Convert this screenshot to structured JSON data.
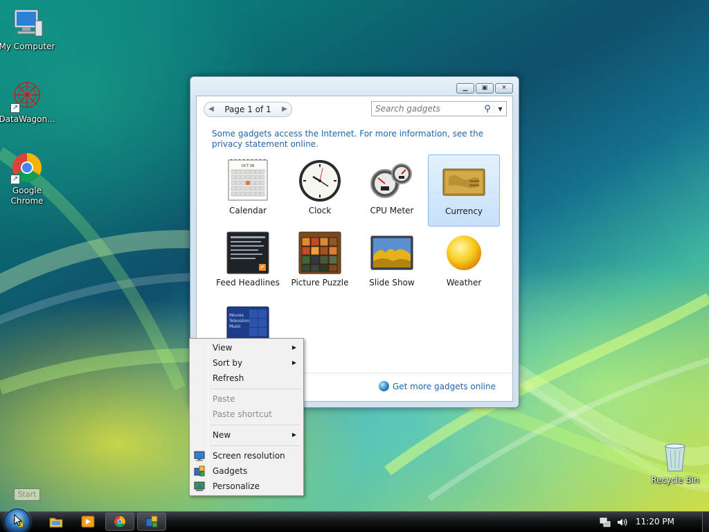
{
  "desktop": {
    "icons": [
      {
        "label": "My Computer",
        "icon": "computer-icon"
      },
      {
        "label": "DataWagon...",
        "icon": "datawagon-icon"
      },
      {
        "label": "Google Chrome",
        "icon": "chrome-icon"
      },
      {
        "label": "Recycle Bin",
        "icon": "recycle-bin-icon"
      }
    ]
  },
  "gadget_window": {
    "page_label": "Page 1 of 1",
    "search_placeholder": "Search gadgets",
    "info_text": "Some gadgets access the Internet.  For more information, see the privacy statement online.",
    "gadgets": [
      {
        "label": "Calendar",
        "icon": "calendar-icon"
      },
      {
        "label": "Clock",
        "icon": "clock-icon"
      },
      {
        "label": "CPU Meter",
        "icon": "cpu-meter-icon"
      },
      {
        "label": "Currency",
        "icon": "currency-icon",
        "selected": true
      },
      {
        "label": "Feed Headlines",
        "icon": "feed-headlines-icon"
      },
      {
        "label": "Picture Puzzle",
        "icon": "picture-puzzle-icon"
      },
      {
        "label": "Slide Show",
        "icon": "slide-show-icon"
      },
      {
        "label": "Weather",
        "icon": "weather-icon"
      },
      {
        "label": "",
        "icon": "media-center-icon",
        "thumb_lines": [
          "Movies",
          "Television",
          "Music"
        ]
      }
    ],
    "calendar_month": "OCT 08",
    "more_online_label": "Get more gadgets online"
  },
  "context_menu": {
    "items": [
      {
        "label": "View",
        "submenu": true,
        "disabled": false
      },
      {
        "label": "Sort by",
        "submenu": true,
        "disabled": false
      },
      {
        "label": "Refresh",
        "submenu": false,
        "disabled": false
      },
      {
        "label": "Paste",
        "submenu": false,
        "disabled": true
      },
      {
        "label": "Paste shortcut",
        "submenu": false,
        "disabled": true
      },
      {
        "label": "New",
        "submenu": true,
        "disabled": false
      },
      {
        "label": "Screen resolution",
        "submenu": false,
        "disabled": false,
        "icon": "screen-resolution-icon"
      },
      {
        "label": "Gadgets",
        "submenu": false,
        "disabled": false,
        "icon": "gadgets-icon"
      },
      {
        "label": "Personalize",
        "submenu": false,
        "disabled": false,
        "icon": "personalize-icon"
      }
    ]
  },
  "taskbar": {
    "start_tooltip": "Start",
    "clock": "11:20 PM",
    "quick_launch": [
      "explorer-icon",
      "media-player-icon",
      "chrome-icon"
    ],
    "tray_icons": [
      "network-icon",
      "volume-icon"
    ]
  },
  "colors": {
    "link_blue": "#1e65b0",
    "selection_blue": "#c6e1fa",
    "taskbar_black": "#101214"
  }
}
